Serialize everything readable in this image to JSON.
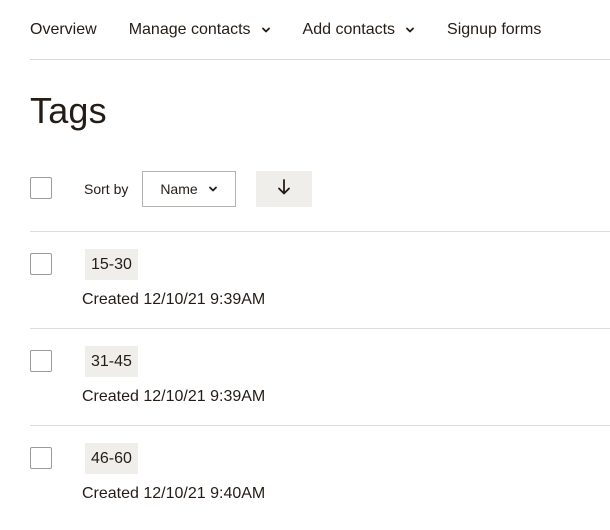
{
  "nav": {
    "items": [
      {
        "label": "Overview",
        "has_dropdown": false
      },
      {
        "label": "Manage contacts",
        "has_dropdown": true
      },
      {
        "label": "Add contacts",
        "has_dropdown": true
      },
      {
        "label": "Signup forms",
        "has_dropdown": false
      }
    ]
  },
  "page": {
    "title": "Tags"
  },
  "toolbar": {
    "sort_label": "Sort by",
    "sort_value": "Name",
    "sort_direction_icon": "arrow-down-icon"
  },
  "tags": [
    {
      "name": "15-30",
      "created": "Created 12/10/21 9:39AM"
    },
    {
      "name": "31-45",
      "created": "Created 12/10/21 9:39AM"
    },
    {
      "name": "46-60",
      "created": "Created 12/10/21 9:40AM"
    }
  ],
  "colors": {
    "text": "#241c15",
    "badge_bg": "#efeeea",
    "divider": "#dedbd8"
  }
}
